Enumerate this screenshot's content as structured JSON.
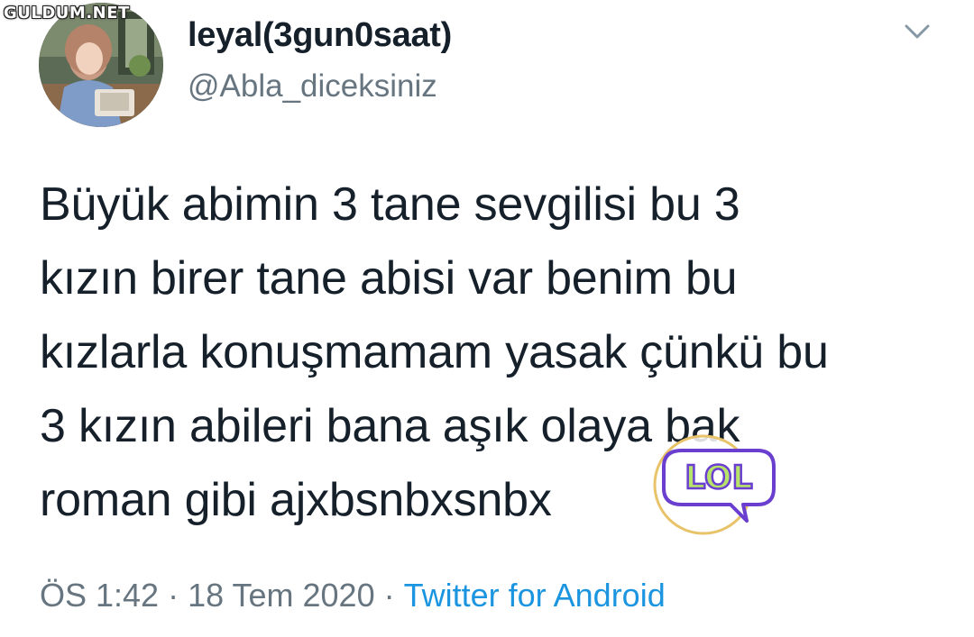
{
  "watermark": {
    "text": "GULDUM.NET"
  },
  "tweet": {
    "display_name": "leyal(3gun0saat)",
    "handle": "@Abla_diceksiniz",
    "text_lines": [
      "Büyük abimin 3 tane sevgilisi bu 3",
      "kızın birer tane abisi var benim bu",
      "kızlarla konuşmamam yasak çünkü bu",
      "3 kızın abileri bana aşık olaya bak",
      "roman gibi ajxbsnbxsnbx"
    ],
    "time": "ÖS 1:42",
    "separator": "·",
    "date": "18 Tem 2020",
    "source": "Twitter for Android"
  },
  "overlay": {
    "badge_text": "LOL"
  },
  "icons": {
    "menu": "chevron-down-icon",
    "avatar": "profile-photo"
  },
  "colors": {
    "text": "#15202b",
    "secondary": "#66757f",
    "link": "#1b95e0",
    "badge_fill": "#b7e36a",
    "badge_outline": "#6a3fd0"
  }
}
